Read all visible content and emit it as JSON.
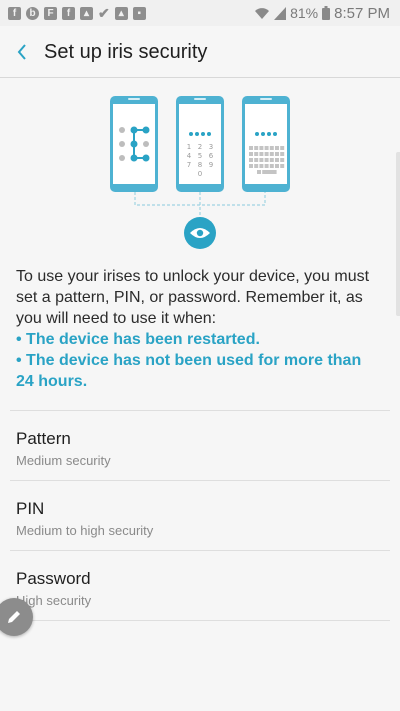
{
  "status_bar": {
    "notification_icons": [
      "facebook-icon",
      "beats-icon",
      "flipboard-icon",
      "facebook-icon",
      "image-icon",
      "check-icon",
      "image-icon",
      "briefcase-icon"
    ],
    "wifi_icon": "wifi-icon",
    "signal_icon": "signal-icon",
    "battery_percent": "81%",
    "battery_icon": "battery-icon",
    "time": "8:57 PM"
  },
  "header": {
    "back_icon": "back-arrow-icon",
    "title": "Set up iris security"
  },
  "illustration": {
    "icon": "eye-icon",
    "pin_digits": [
      "1",
      "2",
      "3",
      "4",
      "5",
      "6",
      "7",
      "8",
      "9",
      "0"
    ],
    "accent_color": "#2aa3c5"
  },
  "description": {
    "text": "To use your irises to unlock your device, you must set a pattern, PIN, or password. Remember it, as you will need to use it when:",
    "bullets": [
      "• The device has been restarted.",
      "• The device has not been used for more than 24 hours."
    ]
  },
  "options": [
    {
      "title": "Pattern",
      "subtitle": "Medium security"
    },
    {
      "title": "PIN",
      "subtitle": "Medium to high security"
    },
    {
      "title": "Password",
      "subtitle": "High security"
    }
  ],
  "fab": {
    "icon": "pencil-icon"
  },
  "colors": {
    "accent": "#2aa3c5",
    "background": "#f6f6f6"
  }
}
